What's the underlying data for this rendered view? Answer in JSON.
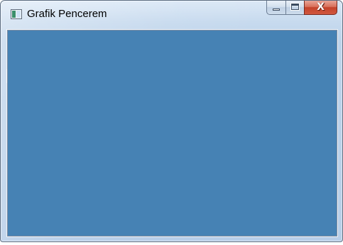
{
  "window": {
    "title": "Grafik Pencerem",
    "icon": "app-window-icon",
    "client_background": "#4682B4"
  },
  "caption_buttons": {
    "minimize": {
      "icon": "minimize-icon"
    },
    "maximize": {
      "icon": "maximize-icon"
    },
    "close": {
      "icon": "close-icon",
      "label": "X"
    }
  }
}
